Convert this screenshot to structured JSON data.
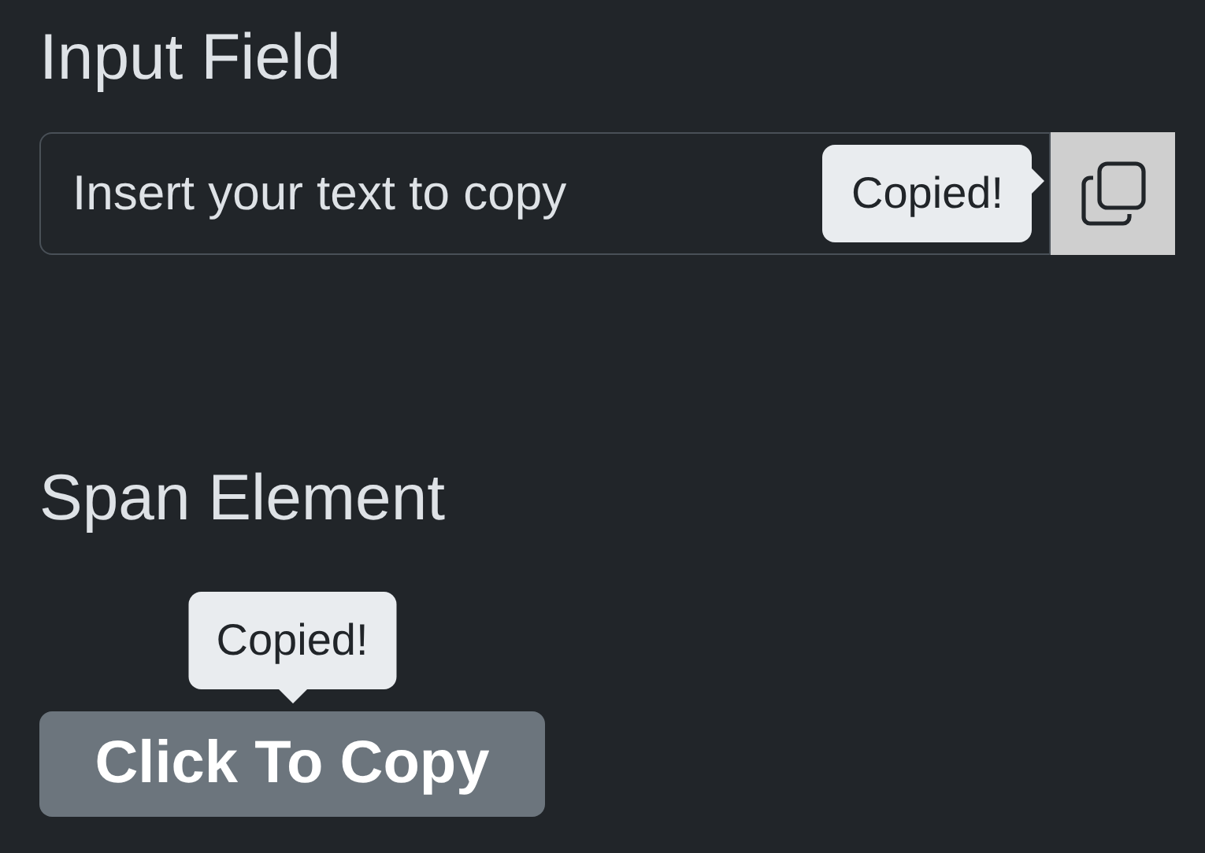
{
  "sections": [
    {
      "kind": "input",
      "heading": "Input Field",
      "value": "Insert your text to copy",
      "tooltip": "Copied!"
    },
    {
      "kind": "span",
      "heading": "Span Element",
      "tooltip": "Copied!",
      "label": "Click To Copy"
    }
  ]
}
